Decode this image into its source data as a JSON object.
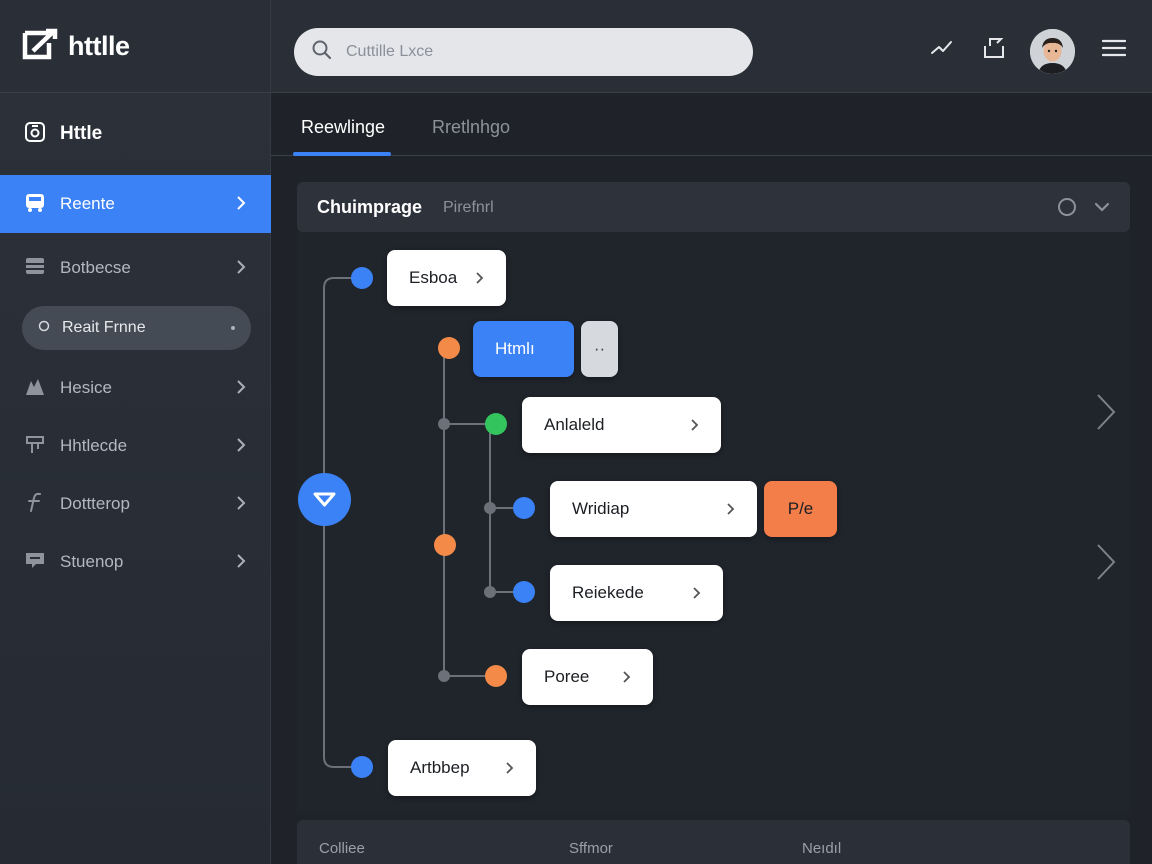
{
  "app": {
    "brand": "httlle"
  },
  "search": {
    "placeholder": "Cuttille Lxce"
  },
  "topbar": {
    "icons": [
      "trend-icon",
      "export-icon",
      "avatar",
      "hamburger-menu-icon"
    ]
  },
  "sidebar": {
    "header": "Httle",
    "items": [
      {
        "label": "Reente",
        "icon": "bus-icon",
        "active": true
      },
      {
        "label": "Botbecse",
        "icon": "layout-icon",
        "active": false
      },
      {
        "label": "Hesice",
        "icon": "chart-icon",
        "active": false
      },
      {
        "label": "Hhtlecde",
        "icon": "signpost-icon",
        "active": false
      },
      {
        "label": "Dottterop",
        "icon": "function-icon",
        "active": false
      },
      {
        "label": "Stuenop",
        "icon": "chat-icon",
        "active": false
      }
    ],
    "pill": {
      "label": "Reait Frnne"
    }
  },
  "tabs": [
    {
      "label": "Reewlinge",
      "active": true
    },
    {
      "label": "Rretlnhgo",
      "active": false
    }
  ],
  "panel": {
    "title": "Chuimprage",
    "subtitle": "Pirefnrl"
  },
  "tree": {
    "nodes": {
      "esboa": "Esboa",
      "html": "Htmlı",
      "grey": "··",
      "anlaleld": "Anlaleld",
      "wridiap": "Wridiap",
      "badge": "P/e",
      "reiekede": "Reiekede",
      "poree": "Poree",
      "artbbep": "Artbbep"
    }
  },
  "table": {
    "headers": [
      "Colliee",
      "Sffmor",
      "Neıdıl"
    ]
  },
  "colors": {
    "accent": "#3b82f6",
    "orange": "#f48a48",
    "green": "#33c45e",
    "background": "#1f2329"
  }
}
